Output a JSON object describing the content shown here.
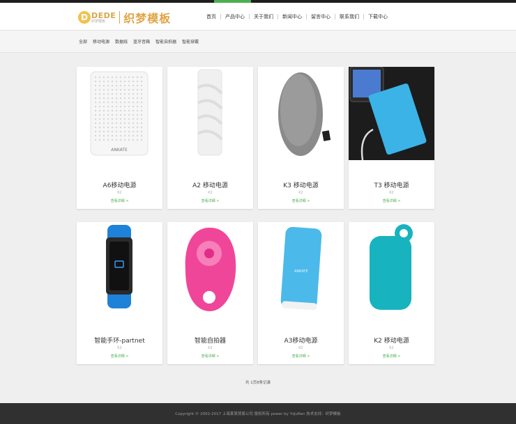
{
  "brand": {
    "logo_letter": "D",
    "logo_english": "DEDE",
    "logo_sub": "织梦模板",
    "logo_chinese": "织梦模板"
  },
  "nav": {
    "items": [
      {
        "label": "首页"
      },
      {
        "label": "产品中心"
      },
      {
        "label": "关于我们"
      },
      {
        "label": "新闻中心"
      },
      {
        "label": "留言中心"
      },
      {
        "label": "联系我们"
      },
      {
        "label": "下载中心"
      }
    ]
  },
  "filters": {
    "items": [
      {
        "label": "全部"
      },
      {
        "label": "移动电源"
      },
      {
        "label": "数据线"
      },
      {
        "label": "蓝牙音箱"
      },
      {
        "label": "智能自拍器"
      },
      {
        "label": "智能穿戴"
      }
    ]
  },
  "products": [
    {
      "title": "A6移动电源",
      "sub": "K2",
      "more": "查看详细 >",
      "image": "power-bank-white-textured"
    },
    {
      "title": "A2 移动电源",
      "sub": "K2",
      "more": "查看详细 >",
      "image": "power-bank-white-twist"
    },
    {
      "title": "K3 移动电源",
      "sub": "K2",
      "more": "查看详细 >",
      "image": "power-bank-grey-pebble"
    },
    {
      "title": "T3 移动电源",
      "sub": "K2",
      "more": "查看详细 >",
      "image": "power-bank-blue-with-phone"
    },
    {
      "title": "智能手环-partnet",
      "sub": "K2",
      "more": "查看详细 >",
      "image": "smart-band-blue"
    },
    {
      "title": "智能自拍器",
      "sub": "K2",
      "more": "查看详细 >",
      "image": "selfie-remote-pink"
    },
    {
      "title": "A3移动电源",
      "sub": "K2",
      "more": "查看详细 >",
      "image": "power-bank-blue-cylinder"
    },
    {
      "title": "K2 移动电源",
      "sub": "K2",
      "more": "查看详细 >",
      "image": "power-bank-teal-keyring"
    }
  ],
  "pagination": {
    "text": "共 1页8条记录"
  },
  "footer": {
    "text": "Copyright © 2002-2017 上海某某贸易公司 版权所有 power by YzJuRen  技术支持：织梦模板"
  },
  "colors": {
    "accent": "#4caf50",
    "logo_gold": "#e0a547",
    "footer_bg": "#303030"
  }
}
